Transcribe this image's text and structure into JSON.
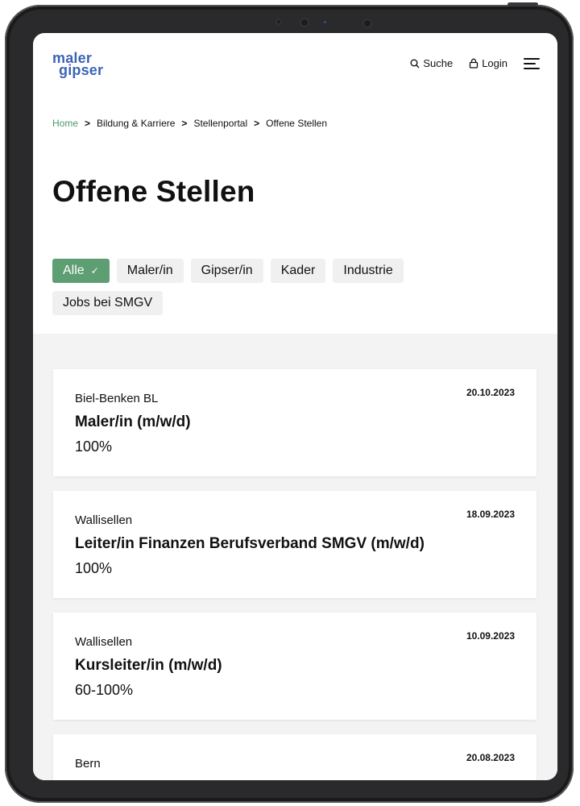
{
  "logo": {
    "line1": "maler",
    "line2": "gipser"
  },
  "header": {
    "search_label": "Suche",
    "login_label": "Login"
  },
  "breadcrumb": [
    "Home",
    "Bildung & Karriere",
    "Stellenportal",
    "Offene Stellen"
  ],
  "page_title": "Offene Stellen",
  "filters": [
    {
      "label": "Alle",
      "active": true
    },
    {
      "label": "Maler/in",
      "active": false
    },
    {
      "label": "Gipser/in",
      "active": false
    },
    {
      "label": "Kader",
      "active": false
    },
    {
      "label": "Industrie",
      "active": false
    },
    {
      "label": "Jobs bei SMGV",
      "active": false
    }
  ],
  "jobs": [
    {
      "location": "Biel-Benken BL",
      "date": "20.10.2023",
      "title": "Maler/in (m/w/d)",
      "workload": "100%"
    },
    {
      "location": "Wallisellen",
      "date": "18.09.2023",
      "title": "Leiter/in Finanzen Berufsverband SMGV (m/w/d)",
      "workload": "100%"
    },
    {
      "location": "Wallisellen",
      "date": "10.09.2023",
      "title": "Kursleiter/in (m/w/d)",
      "workload": "60-100%"
    },
    {
      "location": "Bern",
      "date": "20.08.2023",
      "title": "",
      "workload": ""
    }
  ],
  "colors": {
    "brand": "#3b64b4",
    "accent": "#5d9e72",
    "home_link": "#4a9a6a"
  },
  "icons": {
    "search": "search-icon",
    "login": "lock-icon",
    "menu": "hamburger-menu-icon",
    "check": "checkmark-icon"
  }
}
